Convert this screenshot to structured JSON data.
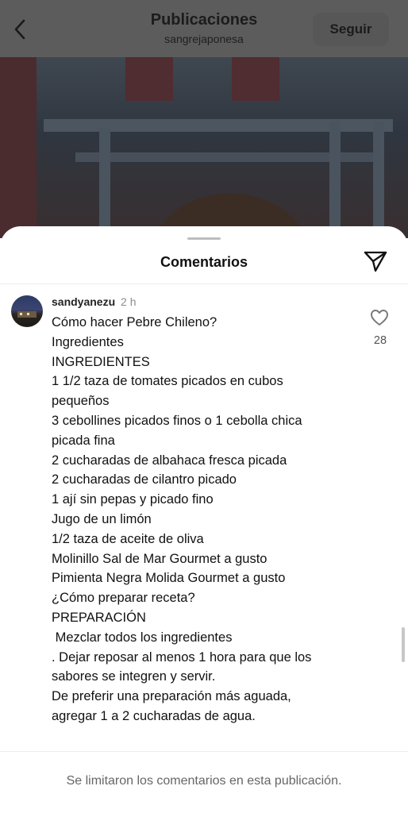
{
  "header": {
    "title": "Publicaciones",
    "subtitle": "sangrejaponesa",
    "follow_label": "Seguir",
    "back_icon": "chevron-left-icon"
  },
  "sheet": {
    "title": "Comentarios",
    "share_icon": "paper-plane-icon"
  },
  "comment": {
    "username": "sandyanezu",
    "time": "2 h",
    "like_count": "28",
    "like_icon": "heart-outline-icon",
    "lines": [
      "Cómo hacer Pebre Chileno?",
      "Ingredientes",
      "INGREDIENTES",
      "1 1/2 taza de tomates picados en cubos",
      "pequeños",
      "3 cebollines picados finos o 1 cebolla chica",
      "picada fina",
      "2 cucharadas de albahaca fresca picada",
      "2 cucharadas de cilantro picado",
      "1 ají sin pepas y picado fino",
      "Jugo de un limón",
      "1/2 taza de aceite de oliva",
      "Molinillo Sal de Mar Gourmet a gusto",
      "Pimienta Negra Molida Gourmet a gusto",
      "¿Cómo preparar receta?",
      "PREPARACIÓN",
      " Mezclar todos los ingredientes",
      ". Dejar reposar al menos 1 hora para que los",
      "sabores se integren y servir.",
      "De preferir una preparación más aguada,",
      "agregar 1 a 2 cucharadas de agua."
    ]
  },
  "footer": {
    "note": "Se limitaron los comentarios en esta publicación."
  },
  "colors": {
    "overlay": "#5c5c5c",
    "text": "#111111",
    "muted": "#8e8e8e"
  }
}
